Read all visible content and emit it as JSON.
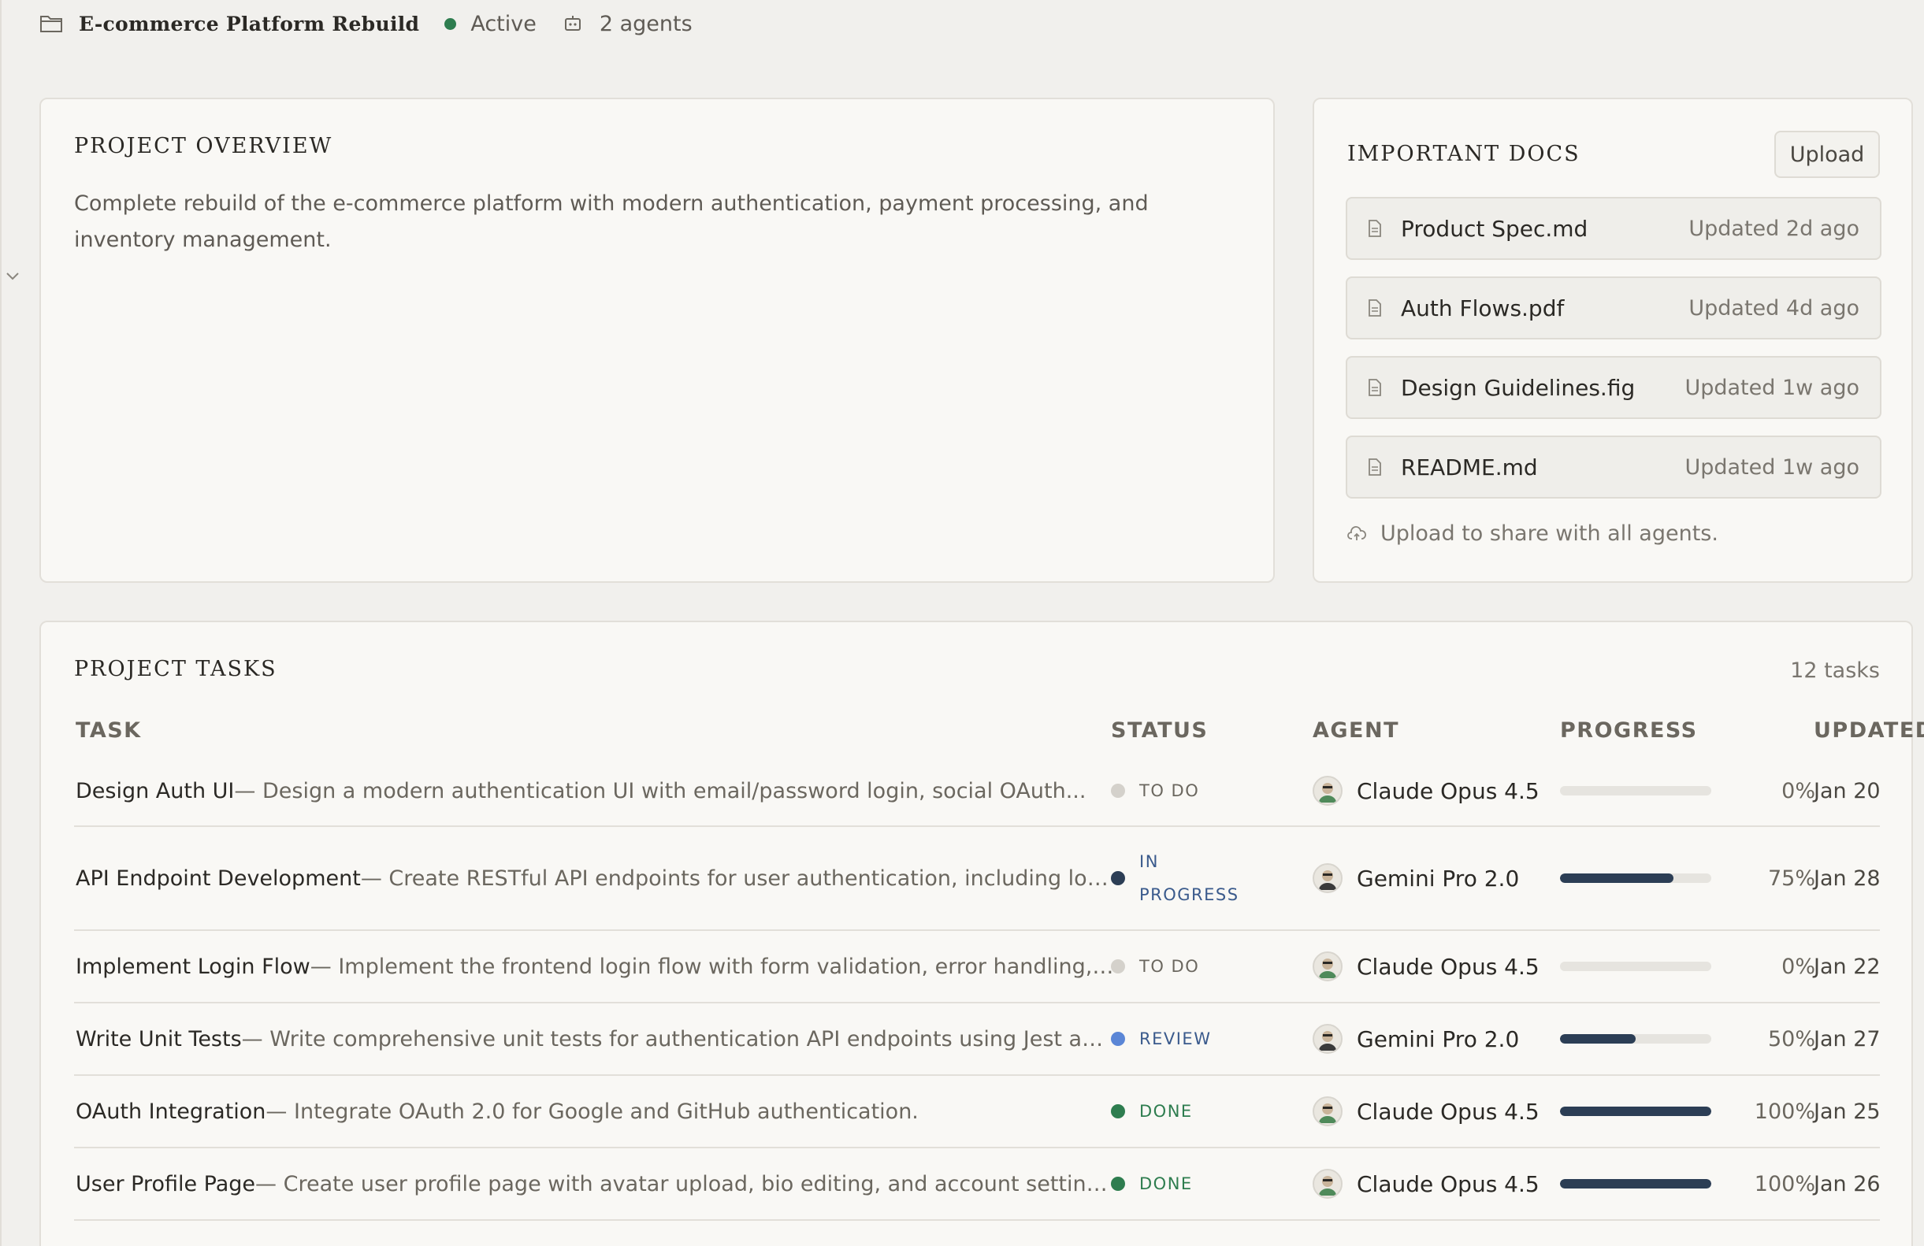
{
  "header": {
    "project_title": "E-commerce Platform Rebuild",
    "status": "Active",
    "agents": "2 agents"
  },
  "overview": {
    "title": "PROJECT OVERVIEW",
    "description": "Complete rebuild of the e-commerce platform with modern authentication, payment processing, and inventory management."
  },
  "docs": {
    "title": "IMPORTANT DOCS",
    "upload_label": "Upload",
    "items": [
      {
        "name": "Product Spec.md",
        "updated": "Updated 2d ago"
      },
      {
        "name": "Auth Flows.pdf",
        "updated": "Updated 4d ago"
      },
      {
        "name": "Design Guidelines.fig",
        "updated": "Updated 1w ago"
      },
      {
        "name": "README.md",
        "updated": "Updated 1w ago"
      }
    ],
    "share_note": "Upload to share with all agents."
  },
  "tasks": {
    "title": "PROJECT TASKS",
    "count": "12 tasks",
    "columns": {
      "task": "TASK",
      "status": "STATUS",
      "agent": "AGENT",
      "progress": "PROGRESS",
      "updated": "UPDATED"
    },
    "rows": [
      {
        "name": "Design Auth UI",
        "desc": " — Design a modern authentication UI with email/password login, social OAuth...",
        "status": "TO DO",
        "status_color": "#d4d1cb",
        "status_text_color": "#6b675f",
        "agent": "Claude Opus 4.5",
        "progress": 0,
        "progress_label": "0%",
        "updated": "Jan 20"
      },
      {
        "name": "API Endpoint Development",
        "desc": " — Create RESTful API endpoints for user authentication, including login,...",
        "status": "IN PROGRESS",
        "status_color": "#2c3e55",
        "status_text_color": "#3a5a8c",
        "agent": "Gemini Pro 2.0",
        "progress": 75,
        "progress_label": "75%",
        "updated": "Jan 28"
      },
      {
        "name": "Implement Login Flow",
        "desc": " — Implement the frontend login flow with form validation, error handling, an...",
        "status": "TO DO",
        "status_color": "#d4d1cb",
        "status_text_color": "#6b675f",
        "agent": "Claude Opus 4.5",
        "progress": 0,
        "progress_label": "0%",
        "updated": "Jan 22"
      },
      {
        "name": "Write Unit Tests",
        "desc": " — Write comprehensive unit tests for authentication API endpoints using Jest and...",
        "status": "REVIEW",
        "status_color": "#5b86d6",
        "status_text_color": "#3a5a8c",
        "agent": "Gemini Pro 2.0",
        "progress": 50,
        "progress_label": "50%",
        "updated": "Jan 27"
      },
      {
        "name": "OAuth Integration",
        "desc": " — Integrate OAuth 2.0 for Google and GitHub authentication.",
        "status": "DONE",
        "status_color": "#2e7d4f",
        "status_text_color": "#2e7d4f",
        "agent": "Claude Opus 4.5",
        "progress": 100,
        "progress_label": "100%",
        "updated": "Jan 25"
      },
      {
        "name": "User Profile Page",
        "desc": " — Create user profile page with avatar upload, bio editing, and account settings.",
        "status": "DONE",
        "status_color": "#2e7d4f",
        "status_text_color": "#2e7d4f",
        "agent": "Claude Opus 4.5",
        "progress": 100,
        "progress_label": "100%",
        "updated": "Jan 26"
      }
    ]
  }
}
